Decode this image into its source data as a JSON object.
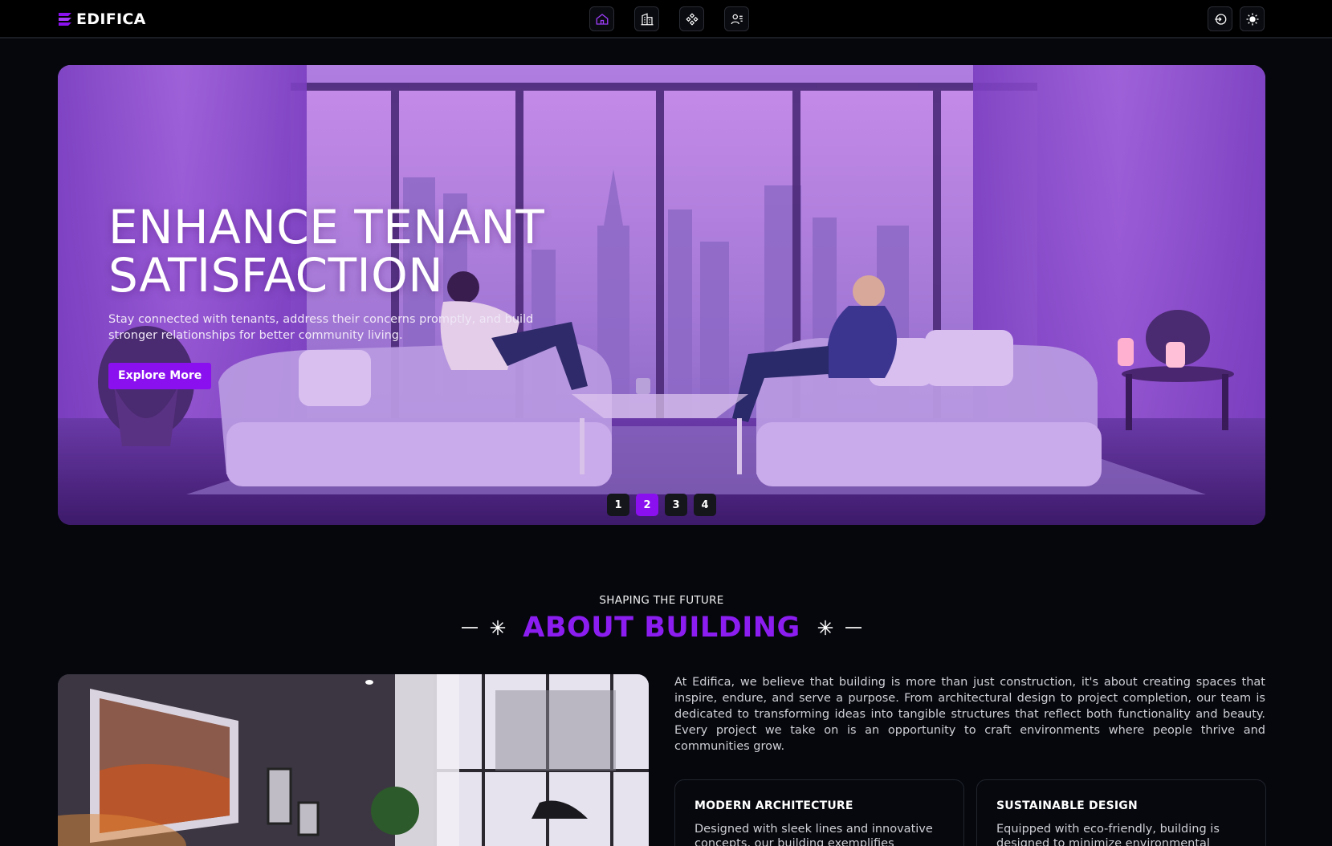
{
  "brand": {
    "name": "EDIFICA"
  },
  "nav": {
    "center_icons": [
      "home-icon",
      "building-icon",
      "services-icon",
      "contacts-icon"
    ],
    "right_icons": [
      "login-icon",
      "theme-toggle-icon"
    ]
  },
  "hero": {
    "title_line1": "ENHANCE TENANT",
    "title_line2": "SATISFACTION",
    "subtitle_line1": "Stay connected with tenants, address their concerns promptly, and build",
    "subtitle_line2": "stronger relationships for better community living.",
    "button_label": "Explore More",
    "pager": [
      "1",
      "2",
      "3",
      "4"
    ],
    "active_page": "2"
  },
  "about": {
    "eyebrow": "SHAPING THE FUTURE",
    "title": "ABOUT BUILDING",
    "paragraph": "At Edifica, we believe that building is more than just construction, it's about creating spaces that inspire, endure, and serve a purpose. From architectural design to project completion, our team is dedicated to transforming ideas into tangible structures that reflect both functionality and beauty. Every project we take on is an opportunity to craft environments where people thrive and communities grow.",
    "cards": [
      {
        "title": "MODERN ARCHITECTURE",
        "text": "Designed with sleek lines and innovative concepts, our building exemplifies"
      },
      {
        "title": "SUSTAINABLE DESIGN",
        "text": "Equipped with eco-friendly, building is designed to minimize environmental"
      }
    ]
  },
  "colors": {
    "accent": "#8b10f0",
    "background": "#05070d"
  }
}
